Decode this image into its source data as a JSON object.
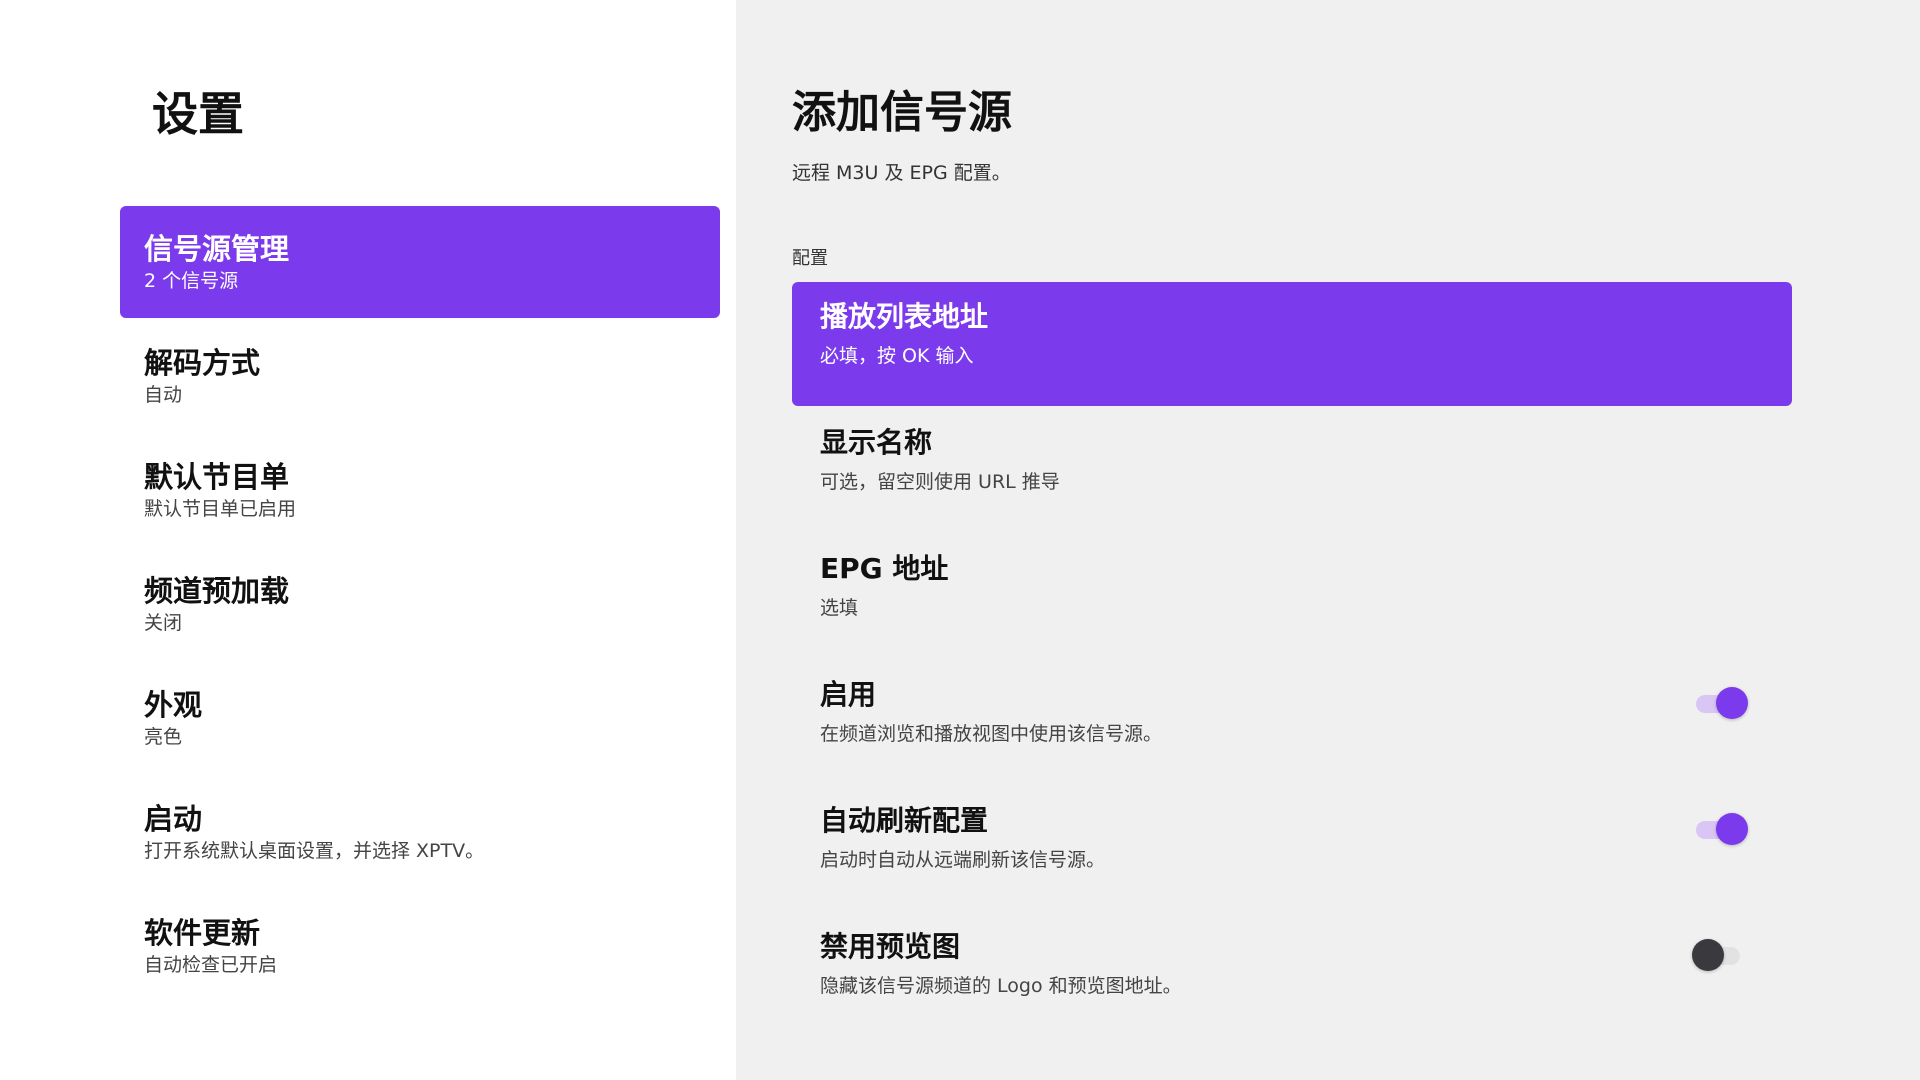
{
  "left": {
    "title": "设置",
    "items": [
      {
        "label": "信号源管理",
        "sub": "2 个信号源",
        "active": true
      },
      {
        "label": "解码方式",
        "sub": "自动"
      },
      {
        "label": "默认节目单",
        "sub": "默认节目单已启用"
      },
      {
        "label": "频道预加载",
        "sub": "关闭"
      },
      {
        "label": "外观",
        "sub": "亮色"
      },
      {
        "label": "启动",
        "sub": "打开系统默认桌面设置，并选择 XPTV。"
      },
      {
        "label": "软件更新",
        "sub": "自动检查已开启"
      }
    ]
  },
  "right": {
    "title": "添加信号源",
    "description": "远程 M3U 及 EPG 配置。",
    "section_label": "配置",
    "rows": [
      {
        "label": "播放列表地址",
        "sub": "必填，按 OK 输入",
        "active": true
      },
      {
        "label": "显示名称",
        "sub": "可选，留空则使用 URL 推导"
      },
      {
        "label": "EPG 地址",
        "sub": "选填"
      },
      {
        "label": "启用",
        "sub": "在频道浏览和播放视图中使用该信号源。",
        "toggle": true
      },
      {
        "label": "自动刷新配置",
        "sub": "启动时自动从远端刷新该信号源。",
        "toggle": true
      },
      {
        "label": "禁用预览图",
        "sub": "隐藏该信号源频道的 Logo 和预览图地址。",
        "toggle": false
      }
    ]
  },
  "colors": {
    "accent": "#7c3aed",
    "left_bg": "#ffffff",
    "right_bg": "#f0f0f0"
  }
}
